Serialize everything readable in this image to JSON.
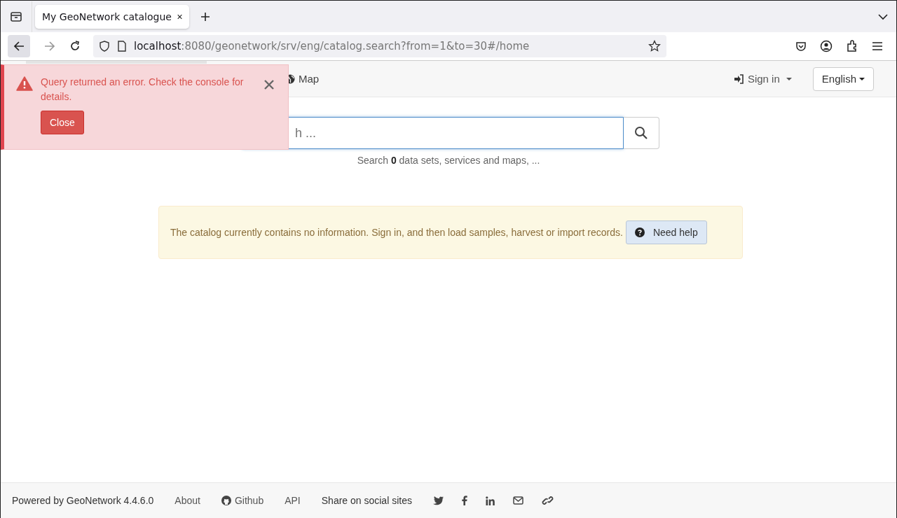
{
  "browser": {
    "tabs": [
      {
        "title": "My GeoNetwork catalogue",
        "selected": true
      }
    ],
    "url": {
      "host": "localhost",
      "rest": ":8080/geonetwork/srv/eng/catalog.search?from=1&to=30#/home"
    }
  },
  "navbar": {
    "items": [
      {
        "label": "Map",
        "kind": "map"
      }
    ],
    "sign_in": "Sign in",
    "language": "English"
  },
  "toast": {
    "message": "Query returned an error. Check the console for details.",
    "button": "Close"
  },
  "search": {
    "placeholder": "h ...",
    "summary": "Search **0** data sets, services and maps, ..."
  },
  "alert": {
    "message": "The catalog currently contains no information. Sign in, and then load samples, harvest or import records.",
    "button": "Need help"
  },
  "footer": {
    "powered_by": "Powered by GeoNetwork 4.4.6.0",
    "links": [
      {
        "label": "About",
        "kind": "text"
      },
      {
        "label": "Github",
        "kind": "github"
      },
      {
        "label": "API",
        "kind": "text"
      }
    ],
    "share_label": "Share on social sites",
    "share": [
      {
        "kind": "twitter"
      },
      {
        "kind": "facebook"
      },
      {
        "kind": "linkedin"
      },
      {
        "kind": "email"
      },
      {
        "kind": "link"
      }
    ]
  }
}
